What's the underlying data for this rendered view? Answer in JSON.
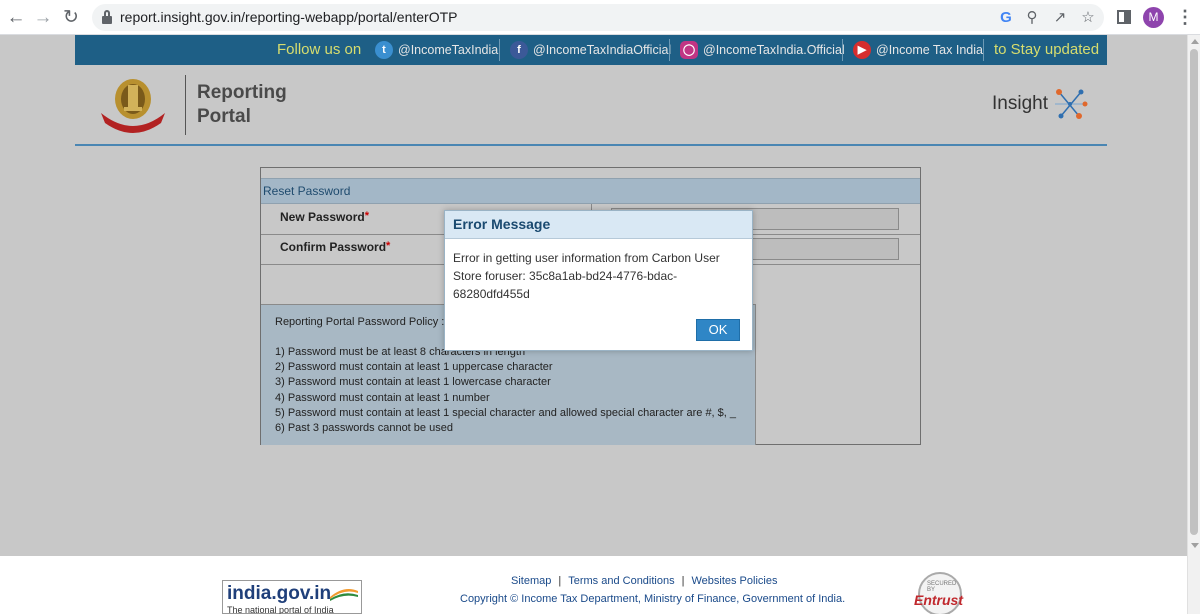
{
  "browser": {
    "url": "report.insight.gov.in/reporting-webapp/portal/enterOTP",
    "profile_initial": "M",
    "back_icon": "arrow-left-icon",
    "forward_icon": "arrow-right-icon",
    "reload_icon": "reload-icon"
  },
  "social": {
    "follow_text": "Follow us on",
    "twitter": "@IncomeTaxIndia",
    "facebook": "@IncomeTaxIndiaOfficial",
    "instagram": "@IncomeTaxIndia.Official",
    "youtube": "@Income Tax India",
    "stay_text": "to Stay updated",
    "text_color": "#d7dd6e",
    "bar_color": "#1e5f86"
  },
  "header": {
    "title_line1": "Reporting",
    "title_line2": "Portal",
    "emblem_text": "INCOME TAX DEPARTMENT",
    "brand": "Insight"
  },
  "form": {
    "section_title": "Reset Password",
    "new_password_label": "New Password",
    "confirm_password_label": "Confirm Password",
    "required_mark": "*",
    "new_password_value": "",
    "confirm_password_value": ""
  },
  "policy": {
    "title": "Reporting Portal Password Policy :",
    "rules": [
      "1) Password must be at least 8 characters in length",
      "2) Password must contain at least 1 uppercase character",
      "3) Password must contain at least 1 lowercase character",
      "4) Password must contain at least 1 number",
      "5) Password must contain at least 1 special character and allowed special character are #, $, _",
      "6) Past 3 passwords cannot be used"
    ]
  },
  "modal": {
    "title": "Error Message",
    "message": "Error in getting user information from Carbon User Store foruser: 35c8a1ab-bd24-4776-bdac-68280dfd455d",
    "ok_label": "OK"
  },
  "footer": {
    "sitemap": "Sitemap",
    "terms": "Terms and Conditions",
    "websites_policies": "Websites Policies",
    "separator": "|",
    "copyright": "Copyright © Income Tax Department, Ministry of Finance, Government of India.",
    "indiagov_title": "india.gov.in",
    "indiagov_sub": "The national portal of India",
    "entrust_brand": "Entrust",
    "entrust_seal": "SECURED BY"
  }
}
